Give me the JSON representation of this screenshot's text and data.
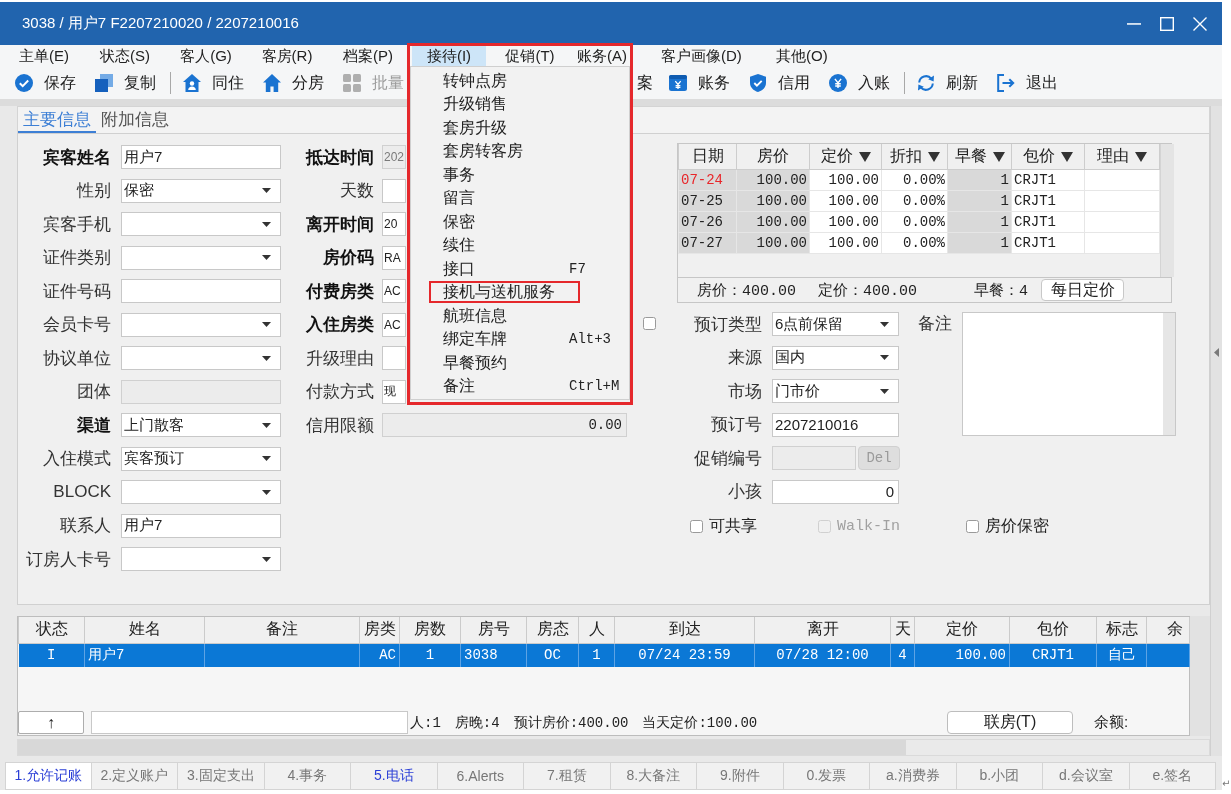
{
  "window": {
    "title": "3038 / 用户7 F2207210020 / 2207210016"
  },
  "menu_bar": [
    {
      "label": "主单(E)",
      "selected": false
    },
    {
      "label": "状态(S)",
      "selected": false
    },
    {
      "label": "客人(G)",
      "selected": false
    },
    {
      "label": "客房(R)",
      "selected": false
    },
    {
      "label": "档案(P)",
      "selected": false
    },
    {
      "label": "接待(I)",
      "selected": true
    },
    {
      "label": "促销(T)",
      "selected": false
    },
    {
      "label": "账务(A)",
      "selected": false
    },
    {
      "label": "客户画像(D)",
      "selected": false
    },
    {
      "label": "其他(O)",
      "selected": false
    }
  ],
  "open_menu": {
    "outlined": true,
    "items": [
      {
        "label": "转钟点房",
        "outlined": false
      },
      {
        "label": "升级销售",
        "outlined": false
      },
      {
        "label": "套房升级",
        "outlined": false
      },
      {
        "label": "套房转客房",
        "outlined": false
      },
      {
        "label": "事务",
        "outlined": false
      },
      {
        "label": "留言",
        "outlined": false
      },
      {
        "label": "保密",
        "outlined": false
      },
      {
        "label": "续住",
        "outlined": false
      },
      {
        "label": "接口",
        "shortcut": "F7",
        "outlined": false
      },
      {
        "label": "接机与送机服务",
        "outlined": true
      },
      {
        "label": "航班信息",
        "outlined": false
      },
      {
        "label": "绑定车牌",
        "shortcut": "Alt+3",
        "outlined": false
      },
      {
        "label": "早餐预约",
        "outlined": false
      },
      {
        "label": "备注",
        "shortcut": "Ctrl+M",
        "outlined": false
      }
    ]
  },
  "toolbar": [
    {
      "kind": "save",
      "label": "保存",
      "disabled": false
    },
    {
      "kind": "copy",
      "label": "复制",
      "disabled": false
    },
    {
      "kind": "separator"
    },
    {
      "kind": "share",
      "label": "同住",
      "disabled": false
    },
    {
      "kind": "assign",
      "label": "分房",
      "disabled": false
    },
    {
      "kind": "batch",
      "label": "批量",
      "disabled": true
    },
    {
      "kind": "covered",
      "label": "案",
      "disabled": false
    },
    {
      "kind": "account",
      "label": "账务",
      "disabled": false
    },
    {
      "kind": "credit",
      "label": "信用",
      "disabled": false
    },
    {
      "kind": "post",
      "label": "入账",
      "disabled": false
    },
    {
      "kind": "separator"
    },
    {
      "kind": "refresh",
      "label": "刷新",
      "disabled": false
    },
    {
      "kind": "exit",
      "label": "退出",
      "disabled": false
    }
  ],
  "tabs": [
    {
      "label": "主要信息",
      "selected": true
    },
    {
      "label": "附加信息",
      "selected": false
    }
  ],
  "guest_form": [
    {
      "label": "宾客姓名",
      "bold": true,
      "kind": "text",
      "value": "用户7",
      "disabled": false
    },
    {
      "label": "性别",
      "bold": false,
      "kind": "select",
      "value": "保密",
      "disabled": false
    },
    {
      "label": "宾客手机",
      "bold": false,
      "kind": "select",
      "disabled": false
    },
    {
      "label": "证件类别",
      "bold": false,
      "kind": "select",
      "disabled": false
    },
    {
      "label": "证件号码",
      "bold": false,
      "kind": "text",
      "disabled": false
    },
    {
      "label": "会员卡号",
      "bold": false,
      "kind": "select",
      "disabled": false
    },
    {
      "label": "协议单位",
      "bold": false,
      "kind": "select",
      "disabled": false
    },
    {
      "label": "团体",
      "bold": false,
      "kind": "text",
      "disabled": true
    },
    {
      "label": "渠道",
      "bold": true,
      "kind": "select",
      "value": "上门散客",
      "disabled": false
    },
    {
      "label": "入住模式",
      "bold": false,
      "kind": "select",
      "value": "宾客预订",
      "disabled": false
    },
    {
      "label": "BLOCK",
      "bold": false,
      "kind": "select",
      "disabled": false
    },
    {
      "label": "联系人",
      "bold": false,
      "kind": "text",
      "value": "用户7",
      "disabled": false
    },
    {
      "label": "订房人卡号",
      "bold": false,
      "kind": "select",
      "disabled": false
    }
  ],
  "stay_form": [
    {
      "label": "抵达时间",
      "bold": true,
      "kind": "text",
      "value": "202",
      "disabled": true
    },
    {
      "label": "天数",
      "bold": false,
      "kind": "text",
      "disabled": false
    },
    {
      "label": "离开时间",
      "bold": true,
      "kind": "text",
      "value": "20",
      "disabled": false
    },
    {
      "label": "房价码",
      "bold": true,
      "kind": "text",
      "value": "RA",
      "disabled": false
    },
    {
      "label": "付费房类",
      "bold": true,
      "kind": "text",
      "value": "AC",
      "disabled": false
    },
    {
      "label": "入住房类",
      "bold": true,
      "kind": "text",
      "value": "AC",
      "disabled": false
    },
    {
      "label": "升级理由",
      "bold": false,
      "kind": "text",
      "disabled": false
    },
    {
      "label": "付款方式",
      "bold": false,
      "kind": "text",
      "value": "现",
      "disabled": false
    },
    {
      "label": "信用限额",
      "bold": false,
      "kind": "amount",
      "value": "0.00",
      "disabled": true
    }
  ],
  "rate_grid": {
    "columns": [
      {
        "label": "日期",
        "filter": false
      },
      {
        "label": "房价",
        "filter": false
      },
      {
        "label": "定价",
        "filter": true
      },
      {
        "label": "折扣",
        "filter": true
      },
      {
        "label": "早餐",
        "filter": true
      },
      {
        "label": "包价",
        "filter": true
      },
      {
        "label": "理由",
        "filter": true
      }
    ],
    "rows": [
      {
        "date": "07-24",
        "current": true,
        "rate": "100.00",
        "price": "100.00",
        "discount": "0.00%",
        "breakfast": "1",
        "package": "CRJT1"
      },
      {
        "date": "07-25",
        "current": false,
        "rate": "100.00",
        "price": "100.00",
        "discount": "0.00%",
        "breakfast": "1",
        "package": "CRJT1"
      },
      {
        "date": "07-26",
        "current": false,
        "rate": "100.00",
        "price": "100.00",
        "discount": "0.00%",
        "breakfast": "1",
        "package": "CRJT1"
      },
      {
        "date": "07-27",
        "current": false,
        "rate": "100.00",
        "price": "100.00",
        "discount": "0.00%",
        "breakfast": "1",
        "package": "CRJT1"
      }
    ],
    "summary": {
      "rate": "房价：400.00",
      "price": "定价：400.00",
      "breakfast": "早餐：4",
      "button": "每日定价"
    }
  },
  "booking_form": {
    "side_checkbox": {
      "checked": false
    },
    "fields": [
      {
        "label": "预订类型",
        "kind": "select",
        "value": "6点前保留",
        "disabled": false
      },
      {
        "label": "来源",
        "kind": "select",
        "value": "国内",
        "disabled": false
      },
      {
        "label": "市场",
        "kind": "select",
        "value": "门市价",
        "disabled": false
      },
      {
        "label": "预订号",
        "kind": "text",
        "value": "2207210016",
        "disabled": false
      },
      {
        "label": "促销编号",
        "kind": "promo",
        "button": "Del",
        "disabled": true
      },
      {
        "label": "小孩",
        "kind": "number",
        "value": "0",
        "disabled": false
      }
    ],
    "remark": {
      "label": "备注"
    },
    "options": [
      {
        "label": "可共享",
        "checked": false,
        "disabled": false
      },
      {
        "label": "Walk-In",
        "checked": false,
        "disabled": true
      },
      {
        "label": "房价保密",
        "checked": false,
        "disabled": false
      }
    ]
  },
  "room_grid": {
    "columns": [
      "状态",
      "姓名",
      "备注",
      "房类",
      "房数",
      "房号",
      "房态",
      "人",
      "到达",
      "离开",
      "天",
      "定价",
      "包价",
      "标志",
      "余"
    ],
    "rows": [
      {
        "selected": true,
        "cells": [
          "I",
          "用户7",
          null,
          "AC",
          "1",
          "3038",
          "OC",
          "1",
          "07/24 23:59",
          "07/28 12:00",
          "4",
          "100.00",
          "CRJT1",
          "自己",
          null
        ]
      }
    ],
    "footer": {
      "up_button": "↑",
      "stats": [
        "人:1",
        "房晚:4",
        "预计房价:400.00",
        "当天定价:100.00"
      ],
      "link_button": "联房(T)",
      "balance_label": "余额:"
    }
  },
  "bottom_tabs": [
    {
      "label": "1.允许记账",
      "selected": true,
      "marked": true
    },
    {
      "label": "2.定义账户",
      "selected": false,
      "marked": false
    },
    {
      "label": "3.固定支出",
      "selected": false,
      "marked": false
    },
    {
      "label": "4.事务",
      "selected": false,
      "marked": false
    },
    {
      "label": "5.电话",
      "selected": false,
      "marked": true
    },
    {
      "label": "6.Alerts",
      "selected": false,
      "marked": false
    },
    {
      "label": "7.租赁",
      "selected": false,
      "marked": false
    },
    {
      "label": "8.大备注",
      "selected": false,
      "marked": false
    },
    {
      "label": "9.附件",
      "selected": false,
      "marked": false
    },
    {
      "label": "0.发票",
      "selected": false,
      "marked": false
    },
    {
      "label": "a.消费券",
      "selected": false,
      "marked": false
    },
    {
      "label": "b.小团",
      "selected": false,
      "marked": false
    },
    {
      "label": "d.会议室",
      "selected": false,
      "marked": false
    },
    {
      "label": "e.签名",
      "selected": false,
      "marked": false
    }
  ],
  "paragraph_mark": "↵"
}
